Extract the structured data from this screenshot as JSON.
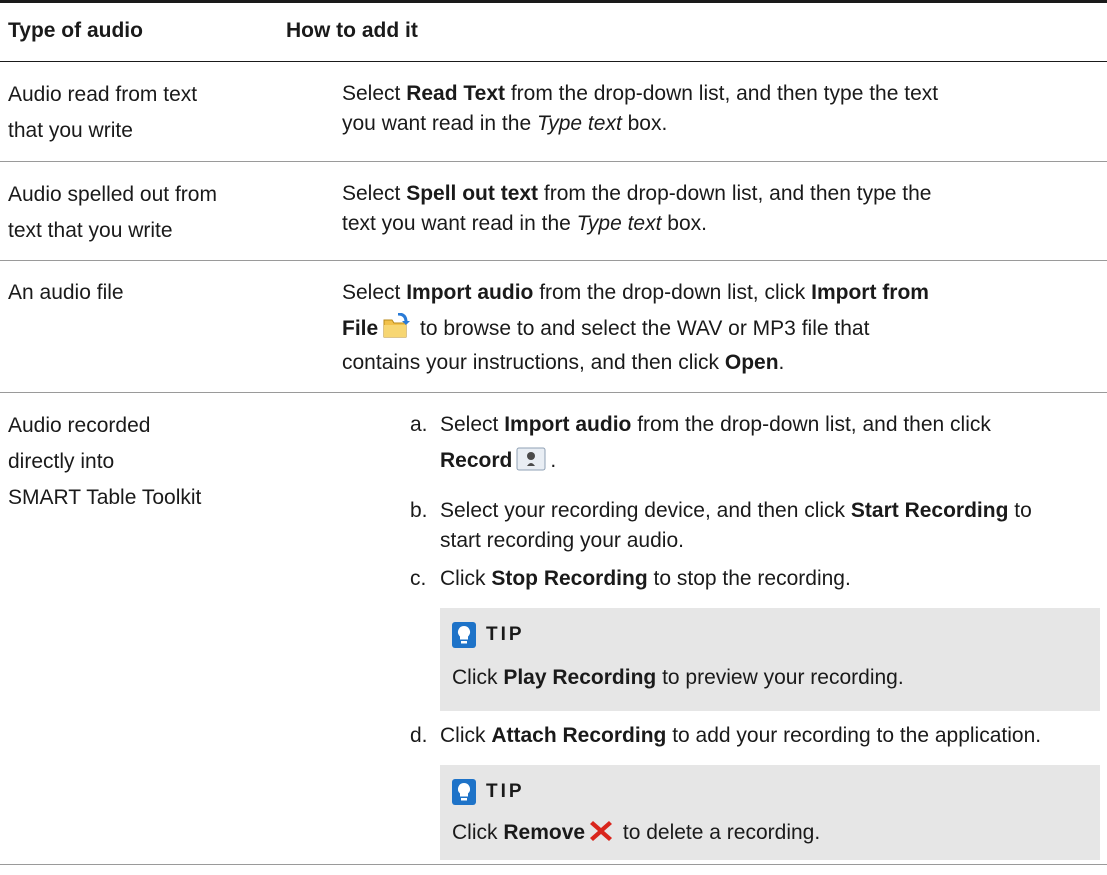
{
  "table": {
    "headers": [
      "Type of audio",
      "How to add it"
    ],
    "rows": [
      {
        "type": [
          "Audio read from text",
          "that you write"
        ],
        "how": {
          "l1_a": "Select ",
          "l1_b": "Read Text",
          "l1_c": " from the drop-down list, and then type the text",
          "l2_a": "you want read in the ",
          "l2_b": "Type text",
          "l2_c": " box."
        }
      },
      {
        "type": [
          "Audio spelled out from",
          "text that you write"
        ],
        "how": {
          "l1_a": "Select ",
          "l1_b": "Spell out text",
          "l1_c": " from the drop-down list, and then type the",
          "l2_a": "text you want read in the ",
          "l2_b": "Type text",
          "l2_c": " box."
        }
      },
      {
        "type": [
          "An audio file"
        ],
        "how": {
          "l1_a": "Select ",
          "l1_b": "Import audio",
          "l1_c": " from the drop-down list, click ",
          "l1_d": "Import from",
          "l2_a": "File",
          "l2_c": " to browse to and select the WAV or MP3 file that",
          "l3_a": "contains your instructions, and then click ",
          "l3_b": "Open",
          "l3_c": "."
        }
      },
      {
        "type": [
          "Audio recorded",
          "directly into",
          "SMART Table Toolkit"
        ],
        "steps": [
          {
            "letter": "a.",
            "l1_a": "Select ",
            "l1_b": "Import audio",
            "l1_c": " from the drop-down list, and then click",
            "l2_b": "Record",
            "l2_c": "."
          },
          {
            "letter": "b.",
            "l1_a": "Select your recording device, and then click ",
            "l1_b": "Start Recording",
            "l1_c": " to",
            "l2_a": "start recording your audio."
          },
          {
            "letter": "c.",
            "l1_a": "Click ",
            "l1_b": "Stop Recording",
            "l1_c": " to stop the recording."
          },
          {
            "letter": "d.",
            "l1_a": "Click ",
            "l1_b": "Attach Recording",
            "l1_c": " to add your recording to the application."
          }
        ],
        "tips": [
          {
            "title": "TIP",
            "a": "Click ",
            "b": "Play Recording",
            "c": " to preview your recording."
          },
          {
            "title": "TIP",
            "a": "Click ",
            "b": "Remove",
            "c": " to delete a recording."
          }
        ]
      }
    ]
  },
  "icons": {
    "import_from_file": "folder-import-icon",
    "record": "record-microphone-icon",
    "remove": "red-x-remove-icon",
    "tip": "lightbulb-icon"
  },
  "colors": {
    "tip_background": "#e6e6e6",
    "tip_icon": "#1e73c8",
    "remove_icon": "#d9251c"
  }
}
